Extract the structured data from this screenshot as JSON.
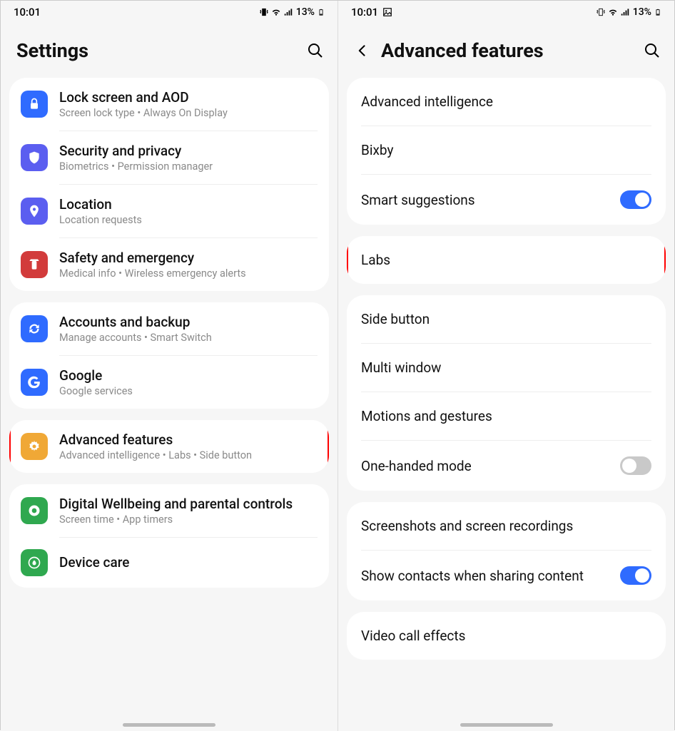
{
  "left": {
    "status": {
      "time": "10:01",
      "battery": "13%"
    },
    "title": "Settings",
    "groups": [
      {
        "items": [
          {
            "icon": "lock-icon",
            "color": "#2f6bff",
            "title": "Lock screen and AOD",
            "sub": "Screen lock type  •  Always On Display"
          },
          {
            "icon": "shield-icon",
            "color": "#5b5ef0",
            "title": "Security and privacy",
            "sub": "Biometrics  •  Permission manager"
          },
          {
            "icon": "pin-icon",
            "color": "#5b5ef0",
            "title": "Location",
            "sub": "Location requests"
          },
          {
            "icon": "alert-icon",
            "color": "#d23b3b",
            "title": "Safety and emergency",
            "sub": "Medical info  •  Wireless emergency alerts"
          }
        ]
      },
      {
        "items": [
          {
            "icon": "sync-icon",
            "color": "#2f6bff",
            "title": "Accounts and backup",
            "sub": "Manage accounts  •  Smart Switch"
          },
          {
            "icon": "google-icon",
            "color": "#2f6bff",
            "title": "Google",
            "sub": "Google services"
          }
        ]
      },
      {
        "items": [
          {
            "icon": "gear-icon",
            "color": "#f0a836",
            "title": "Advanced features",
            "sub": "Advanced intelligence  •  Labs  •  Side button",
            "highlight": true
          }
        ]
      },
      {
        "items": [
          {
            "icon": "wellbeing-icon",
            "color": "#2fa84f",
            "title": "Digital Wellbeing and parental controls",
            "sub": "Screen time  •  App timers"
          },
          {
            "icon": "care-icon",
            "color": "#2fa84f",
            "title": "Device care",
            "sub": ""
          }
        ]
      }
    ]
  },
  "right": {
    "status": {
      "time": "10:01",
      "battery": "13%"
    },
    "title": "Advanced features",
    "groups": [
      [
        {
          "label": "Advanced intelligence",
          "toggle": null
        },
        {
          "label": "Bixby",
          "toggle": null
        },
        {
          "label": "Smart suggestions",
          "toggle": "on"
        }
      ],
      [
        {
          "label": "Labs",
          "toggle": null,
          "highlight": true
        }
      ],
      [
        {
          "label": "Side button",
          "toggle": null
        },
        {
          "label": "Multi window",
          "toggle": null
        },
        {
          "label": "Motions and gestures",
          "toggle": null
        },
        {
          "label": "One-handed mode",
          "toggle": "off"
        }
      ],
      [
        {
          "label": "Screenshots and screen recordings",
          "toggle": null
        },
        {
          "label": "Show contacts when sharing content",
          "toggle": "on"
        }
      ],
      [
        {
          "label": "Video call effects",
          "toggle": null
        }
      ]
    ]
  }
}
